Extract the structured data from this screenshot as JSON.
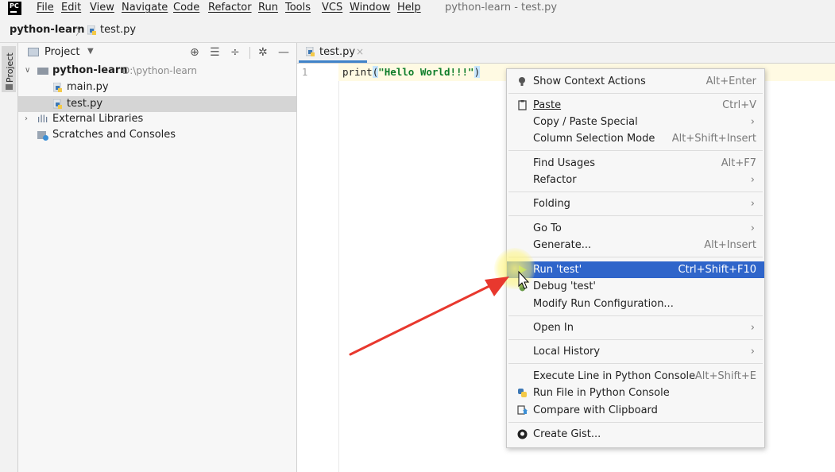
{
  "app": {
    "logo_text": "PC",
    "window_title": "python-learn - test.py"
  },
  "menubar": {
    "items": [
      "File",
      "Edit",
      "View",
      "Navigate",
      "Code",
      "Refactor",
      "Run",
      "Tools",
      "VCS",
      "Window",
      "Help"
    ]
  },
  "breadcrumb": {
    "project": "python-learn",
    "separator": "〉",
    "file": "test.py"
  },
  "tool_strip": {
    "project_label": "Project"
  },
  "project_panel": {
    "title": "Project",
    "tree": {
      "root_name": "python-learn",
      "root_path": "D:\\python-learn",
      "files": [
        "main.py",
        "test.py"
      ],
      "external_libraries": "External Libraries",
      "scratches": "Scratches and Consoles"
    }
  },
  "editor": {
    "tab_label": "test.py",
    "line_number": "1",
    "code": {
      "fn": "print",
      "open": "(",
      "string": "\"Hello World!!!\"",
      "close": ")"
    }
  },
  "context_menu": {
    "show_context_actions": {
      "label": "Show Context Actions",
      "shortcut": "Alt+Enter"
    },
    "paste": {
      "label": "Paste",
      "shortcut": "Ctrl+V"
    },
    "copy_paste_special": {
      "label": "Copy / Paste Special"
    },
    "column_selection_mode": {
      "label": "Column Selection Mode",
      "shortcut": "Alt+Shift+Insert"
    },
    "find_usages": {
      "label": "Find Usages",
      "shortcut": "Alt+F7"
    },
    "refactor": {
      "label": "Refactor"
    },
    "folding": {
      "label": "Folding"
    },
    "go_to": {
      "label": "Go To"
    },
    "generate": {
      "label": "Generate...",
      "shortcut": "Alt+Insert"
    },
    "run": {
      "label": "Run 'test'",
      "shortcut": "Ctrl+Shift+F10"
    },
    "debug": {
      "label": "Debug 'test'"
    },
    "modify_run_config": {
      "label": "Modify Run Configuration..."
    },
    "open_in": {
      "label": "Open In"
    },
    "local_history": {
      "label": "Local History"
    },
    "execute_line": {
      "label": "Execute Line in Python Console",
      "shortcut": "Alt+Shift+E"
    },
    "run_file_console": {
      "label": "Run File in Python Console"
    },
    "compare_clipboard": {
      "label": "Compare with Clipboard"
    },
    "create_gist": {
      "label": "Create Gist..."
    },
    "submenu_arrow": "›"
  },
  "colors": {
    "selection": "#2f65ca",
    "annotation_arrow": "#e8382e",
    "tab_underline": "#4083c9"
  }
}
